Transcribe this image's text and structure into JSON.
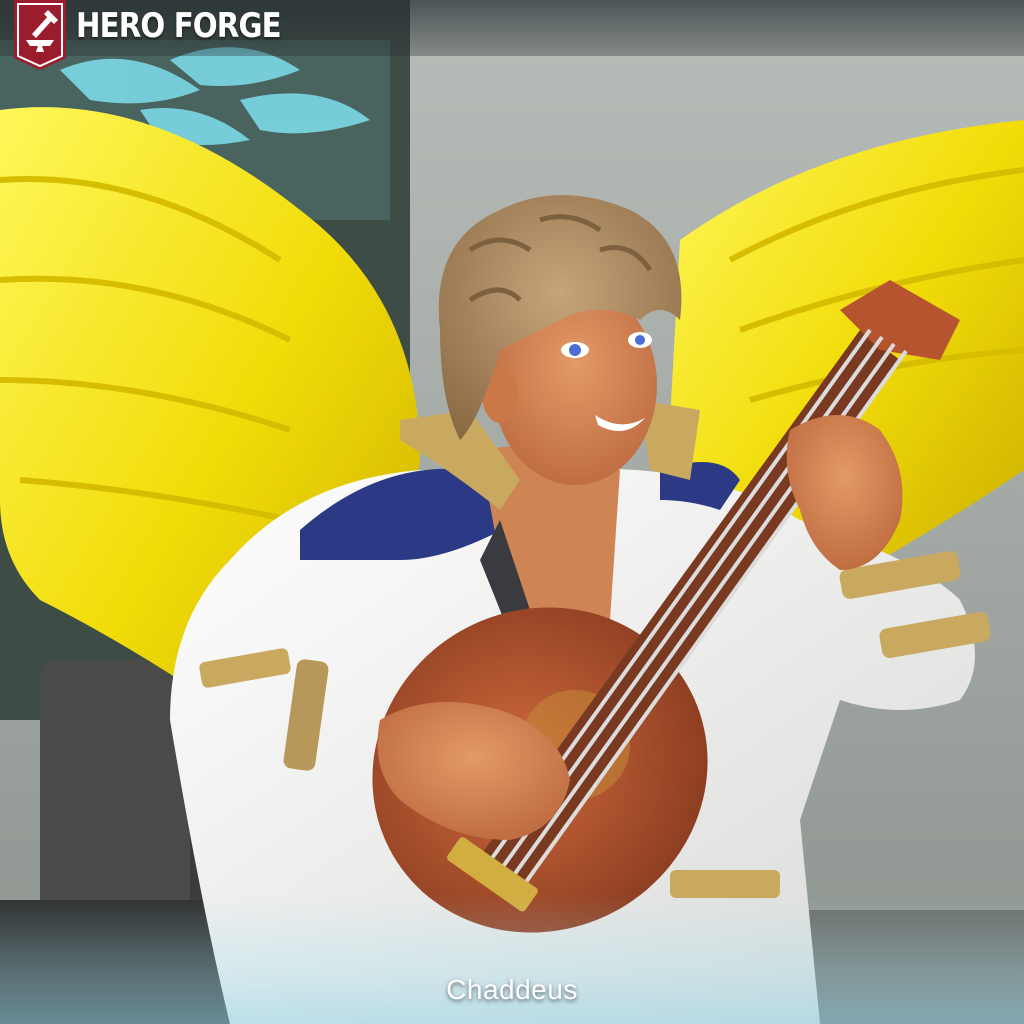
{
  "brand": {
    "name": "HERO FORGE"
  },
  "character": {
    "name": "Chaddeus"
  },
  "colors": {
    "brand_red": "#9b1c2c",
    "wing_yellow": "#f3df10",
    "coat_white": "#f1f1ee",
    "coat_blue": "#2c3a86",
    "trim_gold": "#c9a860",
    "lute_orange": "#b5542f",
    "hair_tan": "#a8865f",
    "skin": "#d98a5a"
  }
}
